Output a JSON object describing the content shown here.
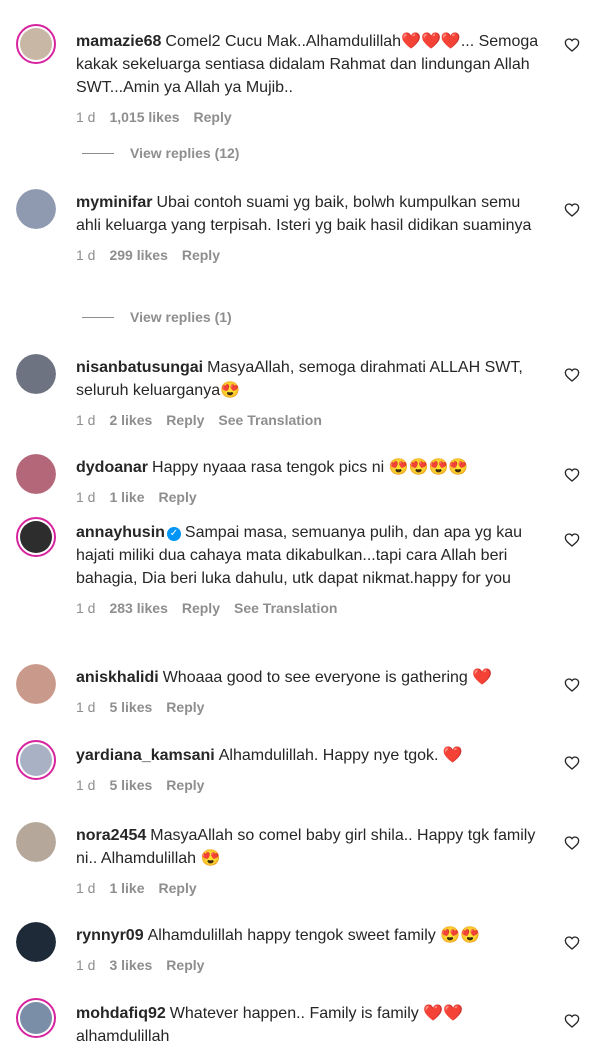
{
  "comments": [
    {
      "user": "mamazie68",
      "text": "Comel2 Cucu Mak..Alhamdulillah❤️❤️❤️... Semoga kakak sekeluarga sentiasa didalam Rahmat dan lindungan Allah SWT...Amin ya Allah ya Mujib..",
      "time": "1 d",
      "likes": "1,015 likes",
      "reply": "Reply",
      "view_replies": "View replies (12)"
    },
    {
      "user": "myminifar",
      "text": "Ubai contoh suami yg baik, bolwh kumpulkan semu ahli keluarga yang terpisah. Isteri yg baik hasil didikan suaminya",
      "time": "1 d",
      "likes": "299 likes",
      "reply": "Reply",
      "view_replies": "View replies (1)"
    },
    {
      "user": "nisanbatusungai",
      "text": "MasyaAllah, semoga dirahmati ALLAH SWT, seluruh keluarganya😍",
      "time": "1 d",
      "likes": "2 likes",
      "reply": "Reply",
      "translate": "See Translation"
    },
    {
      "user": "dydoanar",
      "text": "Happy nyaaa rasa tengok pics ni 😍😍😍😍",
      "time": "1 d",
      "likes": "1 like",
      "reply": "Reply"
    },
    {
      "user": "annayhusin",
      "verified": "✓",
      "text": "Sampai masa, semuanya pulih, dan apa yg kau hajati miliki dua cahaya mata dikabulkan...tapi cara Allah beri bahagia, Dia beri luka dahulu, utk dapat nikmat.happy for you",
      "time": "1 d",
      "likes": "283 likes",
      "reply": "Reply",
      "translate": "See Translation"
    },
    {
      "user": "aniskhalidi",
      "text": "Whoaaa good to see everyone is gathering ❤️",
      "time": "1 d",
      "likes": "5 likes",
      "reply": "Reply"
    },
    {
      "user": "yardiana_kamsani",
      "text": "Alhamdulillah. Happy nye tgok. ❤️",
      "time": "1 d",
      "likes": "5 likes",
      "reply": "Reply"
    },
    {
      "user": "nora2454",
      "text": "MasyaAllah so comel baby girl shila.. Happy tgk family ni.. Alhamdulillah 😍",
      "time": "1 d",
      "likes": "1 like",
      "reply": "Reply"
    },
    {
      "user": "rynnyr09",
      "text": "Alhamdulillah happy tengok sweet family 😍😍",
      "time": "1 d",
      "likes": "3 likes",
      "reply": "Reply"
    },
    {
      "user": "mohdafiq92",
      "text": "Whatever happen.. Family is family ❤️❤️ alhamdulillah"
    }
  ],
  "colors": {
    "heart": "#ed4956",
    "muted": "#8e8e8e",
    "verified": "#0095f6",
    "ring": "#d6249f"
  },
  "icons": {
    "like": "heart-outline-icon",
    "verified": "verified-badge-icon"
  }
}
